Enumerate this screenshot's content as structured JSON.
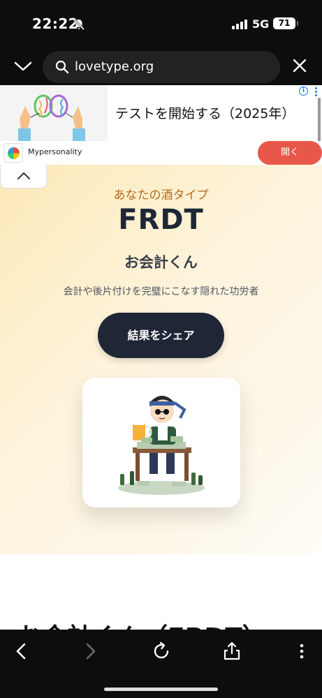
{
  "status_bar": {
    "time": "22:22",
    "network": "5G",
    "battery": "71"
  },
  "browser": {
    "url": "lovetype.org"
  },
  "ad": {
    "headline": "テストを開始する（2025年）",
    "brand": "Mypersonality",
    "open_label": "開く",
    "info_icon": "info-icon"
  },
  "result": {
    "subtitle": "あなたの酒タイプ",
    "code": "FRDT",
    "name": "お会計くん",
    "description": "会計や後片付けを完璧にこなす隠れた功労者",
    "share_label": "結果をシェア",
    "section_heading": "お会計くん（FRDT）"
  },
  "colors": {
    "accent_dark": "#1f2636",
    "subtitle": "#b76b1c",
    "ad_button": "#e8584a"
  },
  "icons": [
    "chevron-down-icon",
    "search-icon",
    "close-icon",
    "chevron-up-icon",
    "back-icon",
    "forward-icon",
    "reload-icon",
    "share-icon",
    "more-icon"
  ]
}
